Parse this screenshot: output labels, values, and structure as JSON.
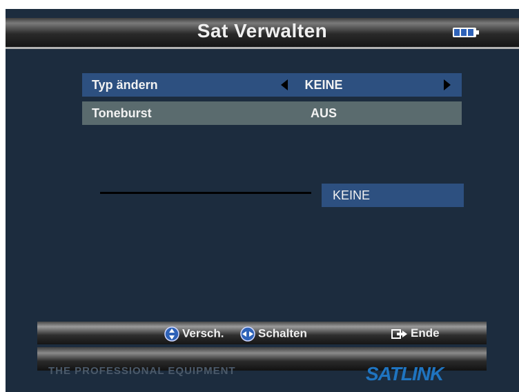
{
  "header": {
    "title": "Sat Verwalten",
    "battery_icon": "battery-icon"
  },
  "menu": [
    {
      "label": "Typ ändern",
      "value": "KEINE"
    },
    {
      "label": "Toneburst",
      "value": "AUS"
    }
  ],
  "status": {
    "value": "KEINE"
  },
  "footer": {
    "move_label": "Versch.",
    "switch_label": "Schalten",
    "exit_label": "Ende",
    "tagline": "THE PROFESSIONAL EQUIPMENT",
    "logo": "SATLINK"
  },
  "colors": {
    "screen_bg": "#1c2c3e",
    "highlight": "#2d5080",
    "row_inactive": "#5a6b6e",
    "logo": "#1f74c0"
  }
}
